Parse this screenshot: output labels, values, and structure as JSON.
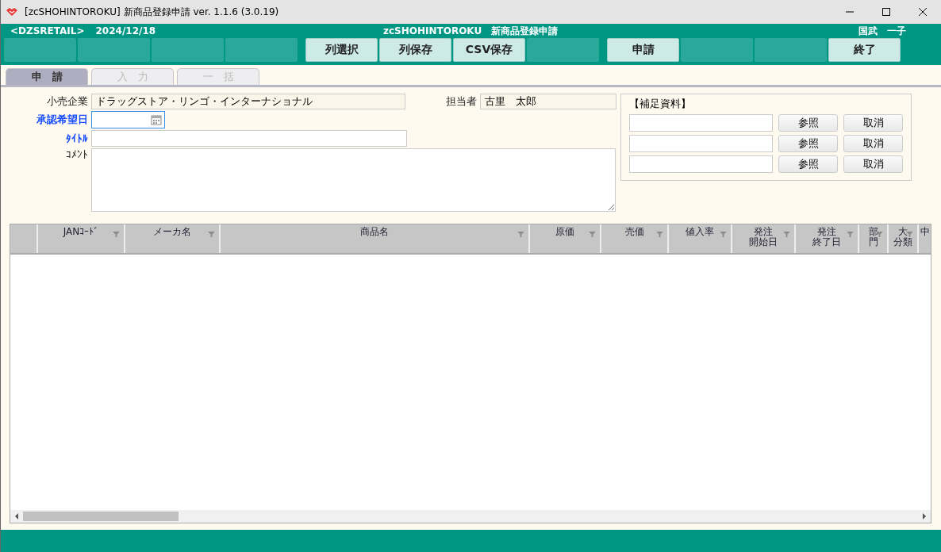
{
  "window": {
    "title": "[zcSHOHINTOROKU] 新商品登録申請 ver. 1.1.6 (3.0.19)"
  },
  "header": {
    "company": "<DZSRETAIL>",
    "date": "2024/12/18",
    "app": "zcSHOHINTOROKU　新商品登録申請",
    "user": "国武　一子",
    "groups": [
      [
        {
          "kind": "blank"
        },
        {
          "kind": "blank"
        },
        {
          "kind": "blank"
        },
        {
          "kind": "blank"
        }
      ],
      [
        {
          "kind": "button",
          "label": "列選択"
        },
        {
          "kind": "button",
          "label": "列保存"
        },
        {
          "kind": "button",
          "label": "CSV保存"
        },
        {
          "kind": "blank"
        }
      ],
      [
        {
          "kind": "button",
          "label": "申請"
        },
        {
          "kind": "blank"
        },
        {
          "kind": "blank"
        },
        {
          "kind": "button",
          "label": "終了"
        }
      ]
    ]
  },
  "tabs": [
    {
      "label": "申　請",
      "selected": true
    },
    {
      "label": "入　力",
      "selected": false
    },
    {
      "label": "一　括",
      "selected": false
    }
  ],
  "form": {
    "retailer": {
      "label": "小売企業",
      "value": "ドラッグストア・リンゴ・インターナショナル"
    },
    "staff": {
      "label": "担当者",
      "value": "古里　太郎"
    },
    "date": {
      "label": "承認希望日",
      "required": true
    },
    "title": {
      "label": "ﾀｲﾄﾙ",
      "required": true
    },
    "comment": {
      "label": "ｺﾒﾝﾄ",
      "required": false
    }
  },
  "attachments": {
    "title": "【補足資料】",
    "rows": [
      {
        "browse": "参照",
        "cancel": "取消"
      },
      {
        "browse": "参照",
        "cancel": "取消"
      },
      {
        "browse": "参照",
        "cancel": "取消"
      }
    ]
  },
  "grid": {
    "columns": [
      {
        "label": "JANｺｰﾄﾞ",
        "filter": true
      },
      {
        "label": "メーカ名",
        "filter": true
      },
      {
        "label": "商品名",
        "filter": true
      },
      {
        "label": "原価",
        "filter": true
      },
      {
        "label": "売価",
        "filter": true
      },
      {
        "label": "値入率",
        "filter": true
      },
      {
        "lines": [
          "発注",
          "開始日"
        ],
        "filter": true
      },
      {
        "lines": [
          "発注",
          "終了日"
        ],
        "filter": true
      },
      {
        "lines": [
          "部",
          "門"
        ],
        "filter": true
      },
      {
        "lines": [
          "大",
          "分類"
        ],
        "filter": true
      },
      {
        "label": "中",
        "filter": false
      }
    ]
  }
}
